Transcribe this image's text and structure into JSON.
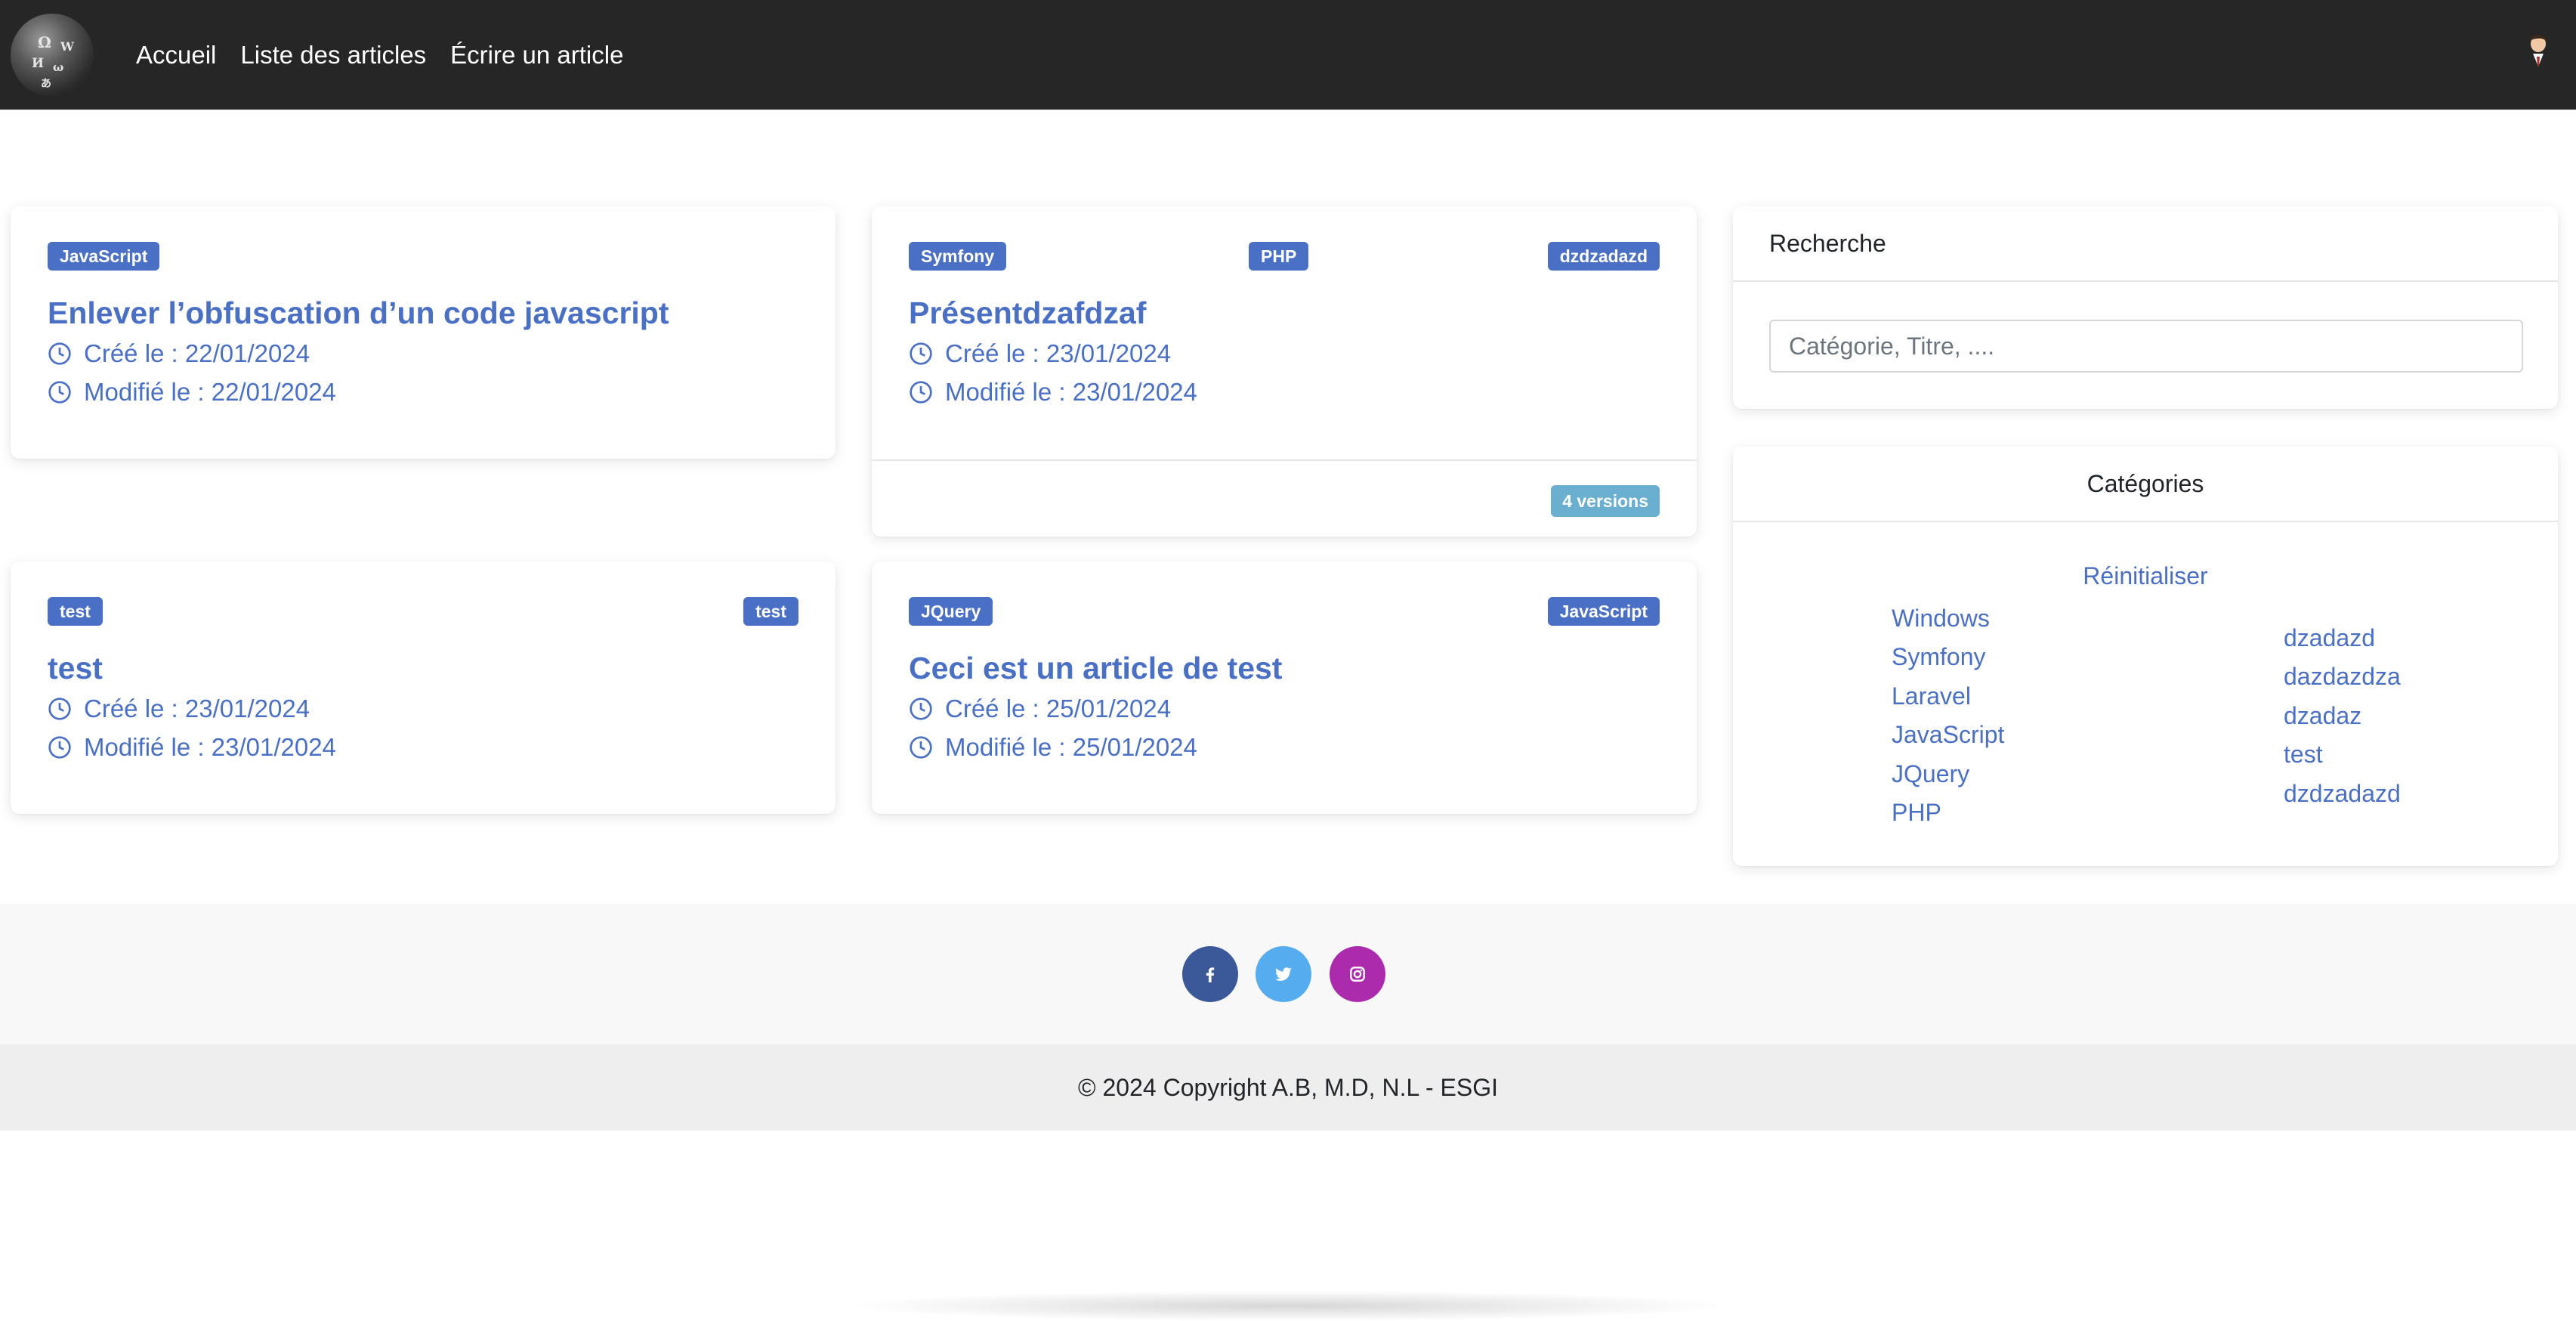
{
  "nav": {
    "links": [
      "Accueil",
      "Liste des articles",
      "Écrire un article"
    ]
  },
  "articles": [
    {
      "tags": [
        "JavaScript"
      ],
      "title": "Enlever l’obfuscation d’un code javascript",
      "created": "Créé le : 22/01/2024",
      "modified": "Modifié le : 22/01/2024"
    },
    {
      "tags": [
        "Symfony",
        "PHP",
        "dzdzadazd"
      ],
      "title": "Présentdzafdzaf",
      "created": "Créé le : 23/01/2024",
      "modified": "Modifié le : 23/01/2024",
      "versions": "4 versions"
    },
    {
      "tags": [
        "test",
        "test"
      ],
      "title": "test",
      "created": "Créé le : 23/01/2024",
      "modified": "Modifié le : 23/01/2024"
    },
    {
      "tags": [
        "JQuery",
        "JavaScript"
      ],
      "title": "Ceci est un article de test",
      "created": "Créé le : 25/01/2024",
      "modified": "Modifié le : 25/01/2024"
    }
  ],
  "search": {
    "title": "Recherche",
    "placeholder": "Catégorie, Titre, ...."
  },
  "categories": {
    "title": "Catégories",
    "reset": "Réinitialiser",
    "col1": [
      "Windows",
      "Symfony",
      "Laravel",
      "JavaScript",
      "JQuery",
      "PHP"
    ],
    "col2": [
      "dzadazd",
      "dazdazdza",
      "dzadaz",
      "test",
      "dzdzadazd"
    ]
  },
  "footer": {
    "social": [
      "facebook-icon",
      "twitter-icon",
      "instagram-icon"
    ],
    "copyright": "© 2024 Copyright A.B, M.D, N.L - ESGI"
  },
  "colors": {
    "navbar": "#262626",
    "accent": "#4a70c6",
    "versions_badge": "#6aaed0",
    "facebook": "#3b5998",
    "twitter": "#55acee",
    "instagram": "#ac2bac"
  }
}
